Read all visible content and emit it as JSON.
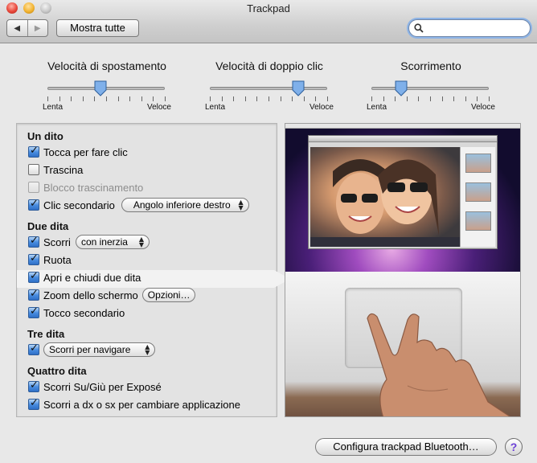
{
  "window": {
    "title": "Trackpad"
  },
  "toolbar": {
    "back_icon": "back-arrow-icon",
    "forward_icon": "forward-arrow-icon",
    "back_glyph": "◀",
    "forward_glyph": "▶",
    "show_all_label": "Mostra tutte",
    "search_value": "",
    "search_placeholder": ""
  },
  "sliders": [
    {
      "title": "Velocità di spostamento",
      "min_label": "Lenta",
      "max_label": "Veloce",
      "value_fraction": 0.45
    },
    {
      "title": "Velocità di doppio clic",
      "min_label": "Lenta",
      "max_label": "Veloce",
      "value_fraction": 0.75
    },
    {
      "title": "Scorrimento",
      "min_label": "Lenta",
      "max_label": "Veloce",
      "value_fraction": 0.25
    }
  ],
  "sections": {
    "one_finger": {
      "title": "Un dito",
      "tap_to_click": {
        "label": "Tocca per fare clic",
        "checked": true
      },
      "drag": {
        "label": "Trascina",
        "checked": false
      },
      "drag_lock": {
        "label": "Blocco trascinamento",
        "checked": false,
        "disabled": true
      },
      "secondary_click": {
        "label": "Clic secondario",
        "checked": true,
        "popup": "Angolo inferiore destro"
      }
    },
    "two_fingers": {
      "title": "Due dita",
      "scroll": {
        "label": "Scorri",
        "checked": true,
        "popup": "con inerzia"
      },
      "rotate": {
        "label": "Ruota",
        "checked": true
      },
      "pinch": {
        "label": "Apri e chiudi due dita",
        "checked": true
      },
      "zoom": {
        "label": "Zoom dello schermo",
        "checked": true,
        "button": "Opzioni…"
      },
      "secondary_tap": {
        "label": "Tocco secondario",
        "checked": true
      }
    },
    "three_fingers": {
      "title": "Tre dita",
      "swipe": {
        "checked": true,
        "popup": "Scorri per navigare"
      }
    },
    "four_fingers": {
      "title": "Quattro dita",
      "expose": {
        "label": "Scorri Su/Giù per Exposé",
        "checked": true
      },
      "switch_app": {
        "label": "Scorri a dx o sx per cambiare applicazione",
        "checked": true
      }
    }
  },
  "footer": {
    "bluetooth_button": "Configura trackpad Bluetooth…",
    "help_label": "?"
  },
  "colors": {
    "checkbox_checked": "#4a8ee0",
    "help_accent": "#6b3fd6"
  }
}
